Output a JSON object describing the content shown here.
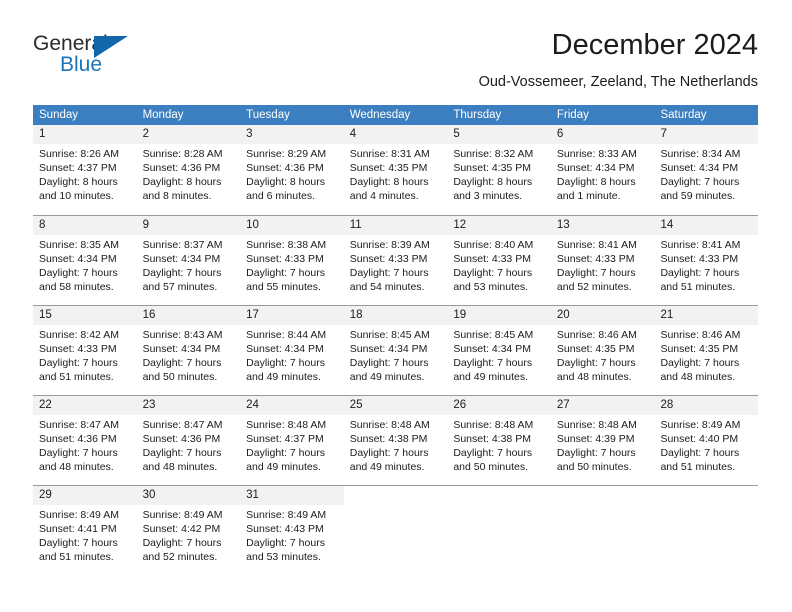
{
  "brand": {
    "name_part1": "General",
    "name_part2": "Blue"
  },
  "header": {
    "title": "December 2024",
    "subtitle": "Oud-Vossemeer, Zeeland, The Netherlands"
  },
  "weekdays": [
    "Sunday",
    "Monday",
    "Tuesday",
    "Wednesday",
    "Thursday",
    "Friday",
    "Saturday"
  ],
  "colors": {
    "header_band": "#3c7fc0",
    "day_band": "#f2f2f2",
    "brand_blue": "#1a74bb",
    "grid_line": "#9a9a9a"
  },
  "weeks": [
    [
      {
        "day": "1",
        "sunrise": "Sunrise: 8:26 AM",
        "sunset": "Sunset: 4:37 PM",
        "daylight_line1": "Daylight: 8 hours",
        "daylight_line2": "and 10 minutes."
      },
      {
        "day": "2",
        "sunrise": "Sunrise: 8:28 AM",
        "sunset": "Sunset: 4:36 PM",
        "daylight_line1": "Daylight: 8 hours",
        "daylight_line2": "and 8 minutes."
      },
      {
        "day": "3",
        "sunrise": "Sunrise: 8:29 AM",
        "sunset": "Sunset: 4:36 PM",
        "daylight_line1": "Daylight: 8 hours",
        "daylight_line2": "and 6 minutes."
      },
      {
        "day": "4",
        "sunrise": "Sunrise: 8:31 AM",
        "sunset": "Sunset: 4:35 PM",
        "daylight_line1": "Daylight: 8 hours",
        "daylight_line2": "and 4 minutes."
      },
      {
        "day": "5",
        "sunrise": "Sunrise: 8:32 AM",
        "sunset": "Sunset: 4:35 PM",
        "daylight_line1": "Daylight: 8 hours",
        "daylight_line2": "and 3 minutes."
      },
      {
        "day": "6",
        "sunrise": "Sunrise: 8:33 AM",
        "sunset": "Sunset: 4:34 PM",
        "daylight_line1": "Daylight: 8 hours",
        "daylight_line2": "and 1 minute."
      },
      {
        "day": "7",
        "sunrise": "Sunrise: 8:34 AM",
        "sunset": "Sunset: 4:34 PM",
        "daylight_line1": "Daylight: 7 hours",
        "daylight_line2": "and 59 minutes."
      }
    ],
    [
      {
        "day": "8",
        "sunrise": "Sunrise: 8:35 AM",
        "sunset": "Sunset: 4:34 PM",
        "daylight_line1": "Daylight: 7 hours",
        "daylight_line2": "and 58 minutes."
      },
      {
        "day": "9",
        "sunrise": "Sunrise: 8:37 AM",
        "sunset": "Sunset: 4:34 PM",
        "daylight_line1": "Daylight: 7 hours",
        "daylight_line2": "and 57 minutes."
      },
      {
        "day": "10",
        "sunrise": "Sunrise: 8:38 AM",
        "sunset": "Sunset: 4:33 PM",
        "daylight_line1": "Daylight: 7 hours",
        "daylight_line2": "and 55 minutes."
      },
      {
        "day": "11",
        "sunrise": "Sunrise: 8:39 AM",
        "sunset": "Sunset: 4:33 PM",
        "daylight_line1": "Daylight: 7 hours",
        "daylight_line2": "and 54 minutes."
      },
      {
        "day": "12",
        "sunrise": "Sunrise: 8:40 AM",
        "sunset": "Sunset: 4:33 PM",
        "daylight_line1": "Daylight: 7 hours",
        "daylight_line2": "and 53 minutes."
      },
      {
        "day": "13",
        "sunrise": "Sunrise: 8:41 AM",
        "sunset": "Sunset: 4:33 PM",
        "daylight_line1": "Daylight: 7 hours",
        "daylight_line2": "and 52 minutes."
      },
      {
        "day": "14",
        "sunrise": "Sunrise: 8:41 AM",
        "sunset": "Sunset: 4:33 PM",
        "daylight_line1": "Daylight: 7 hours",
        "daylight_line2": "and 51 minutes."
      }
    ],
    [
      {
        "day": "15",
        "sunrise": "Sunrise: 8:42 AM",
        "sunset": "Sunset: 4:33 PM",
        "daylight_line1": "Daylight: 7 hours",
        "daylight_line2": "and 51 minutes."
      },
      {
        "day": "16",
        "sunrise": "Sunrise: 8:43 AM",
        "sunset": "Sunset: 4:34 PM",
        "daylight_line1": "Daylight: 7 hours",
        "daylight_line2": "and 50 minutes."
      },
      {
        "day": "17",
        "sunrise": "Sunrise: 8:44 AM",
        "sunset": "Sunset: 4:34 PM",
        "daylight_line1": "Daylight: 7 hours",
        "daylight_line2": "and 49 minutes."
      },
      {
        "day": "18",
        "sunrise": "Sunrise: 8:45 AM",
        "sunset": "Sunset: 4:34 PM",
        "daylight_line1": "Daylight: 7 hours",
        "daylight_line2": "and 49 minutes."
      },
      {
        "day": "19",
        "sunrise": "Sunrise: 8:45 AM",
        "sunset": "Sunset: 4:34 PM",
        "daylight_line1": "Daylight: 7 hours",
        "daylight_line2": "and 49 minutes."
      },
      {
        "day": "20",
        "sunrise": "Sunrise: 8:46 AM",
        "sunset": "Sunset: 4:35 PM",
        "daylight_line1": "Daylight: 7 hours",
        "daylight_line2": "and 48 minutes."
      },
      {
        "day": "21",
        "sunrise": "Sunrise: 8:46 AM",
        "sunset": "Sunset: 4:35 PM",
        "daylight_line1": "Daylight: 7 hours",
        "daylight_line2": "and 48 minutes."
      }
    ],
    [
      {
        "day": "22",
        "sunrise": "Sunrise: 8:47 AM",
        "sunset": "Sunset: 4:36 PM",
        "daylight_line1": "Daylight: 7 hours",
        "daylight_line2": "and 48 minutes."
      },
      {
        "day": "23",
        "sunrise": "Sunrise: 8:47 AM",
        "sunset": "Sunset: 4:36 PM",
        "daylight_line1": "Daylight: 7 hours",
        "daylight_line2": "and 48 minutes."
      },
      {
        "day": "24",
        "sunrise": "Sunrise: 8:48 AM",
        "sunset": "Sunset: 4:37 PM",
        "daylight_line1": "Daylight: 7 hours",
        "daylight_line2": "and 49 minutes."
      },
      {
        "day": "25",
        "sunrise": "Sunrise: 8:48 AM",
        "sunset": "Sunset: 4:38 PM",
        "daylight_line1": "Daylight: 7 hours",
        "daylight_line2": "and 49 minutes."
      },
      {
        "day": "26",
        "sunrise": "Sunrise: 8:48 AM",
        "sunset": "Sunset: 4:38 PM",
        "daylight_line1": "Daylight: 7 hours",
        "daylight_line2": "and 50 minutes."
      },
      {
        "day": "27",
        "sunrise": "Sunrise: 8:48 AM",
        "sunset": "Sunset: 4:39 PM",
        "daylight_line1": "Daylight: 7 hours",
        "daylight_line2": "and 50 minutes."
      },
      {
        "day": "28",
        "sunrise": "Sunrise: 8:49 AM",
        "sunset": "Sunset: 4:40 PM",
        "daylight_line1": "Daylight: 7 hours",
        "daylight_line2": "and 51 minutes."
      }
    ],
    [
      {
        "day": "29",
        "sunrise": "Sunrise: 8:49 AM",
        "sunset": "Sunset: 4:41 PM",
        "daylight_line1": "Daylight: 7 hours",
        "daylight_line2": "and 51 minutes."
      },
      {
        "day": "30",
        "sunrise": "Sunrise: 8:49 AM",
        "sunset": "Sunset: 4:42 PM",
        "daylight_line1": "Daylight: 7 hours",
        "daylight_line2": "and 52 minutes."
      },
      {
        "day": "31",
        "sunrise": "Sunrise: 8:49 AM",
        "sunset": "Sunset: 4:43 PM",
        "daylight_line1": "Daylight: 7 hours",
        "daylight_line2": "and 53 minutes."
      },
      {
        "day": "",
        "sunrise": "",
        "sunset": "",
        "daylight_line1": "",
        "daylight_line2": ""
      },
      {
        "day": "",
        "sunrise": "",
        "sunset": "",
        "daylight_line1": "",
        "daylight_line2": ""
      },
      {
        "day": "",
        "sunrise": "",
        "sunset": "",
        "daylight_line1": "",
        "daylight_line2": ""
      },
      {
        "day": "",
        "sunrise": "",
        "sunset": "",
        "daylight_line1": "",
        "daylight_line2": ""
      }
    ]
  ]
}
